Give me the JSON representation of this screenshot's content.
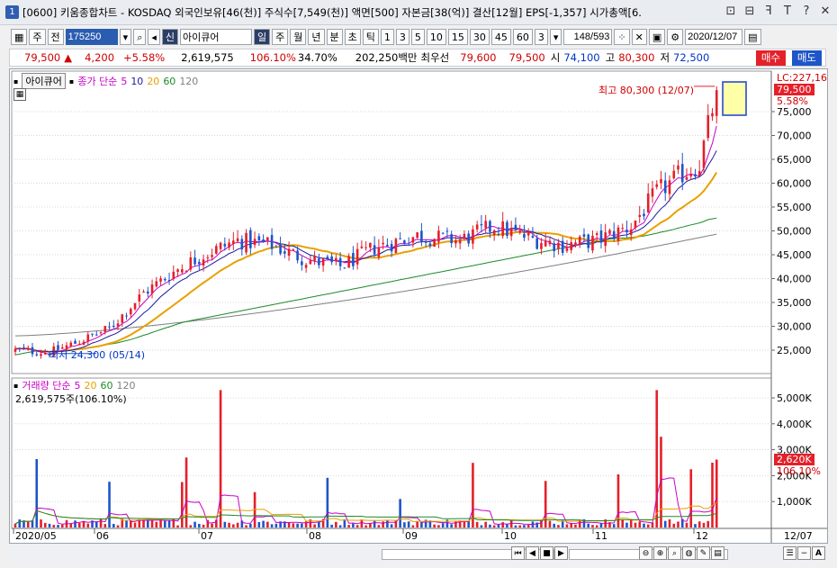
{
  "window": {
    "number": "1",
    "title": "[0600] 키움종합차트 - KOSDAQ 외국인보유[46(천)] 주식수[7,549(천)] 액면[500] 자본금[38(억)] 결산[12월] EPS[-1,357] 시가총액[6.",
    "buttons": [
      "⊡",
      "⊟",
      "ꟻ",
      "T",
      "?",
      "✕"
    ]
  },
  "toolbar": {
    "mode1": "주",
    "mode2": "전",
    "code": "175250",
    "badge": "신",
    "stock_name": "아이큐어",
    "periods": [
      "일",
      "주",
      "월",
      "년",
      "분",
      "초",
      "틱"
    ],
    "active_period": "일",
    "intervals": [
      "1",
      "3",
      "5",
      "10",
      "15",
      "30",
      "45",
      "60"
    ],
    "interval_value": "3",
    "page": "148/593",
    "date": "2020/12/07"
  },
  "quote": {
    "price": "79,500",
    "arrow": "▲",
    "change": "4,200",
    "change_pct": "+5.58%",
    "volume": "2,619,575",
    "volume_ratio": "106.10%",
    "turnover": "34.70%",
    "amount": "202,250백만",
    "best_ask_label": "최우선",
    "ask": "79,600",
    "bid": "79,500",
    "open_label": "시",
    "open": "74,100",
    "high_label": "고",
    "high": "80,300",
    "low_label": "저",
    "low": "72,500",
    "buy_label": "매수",
    "sell_label": "매도"
  },
  "price_panel": {
    "stock_tag": "아이큐어",
    "ma_label": "종가 단순",
    "ma_periods": [
      "5",
      "10",
      "20",
      "60",
      "120"
    ],
    "lc_label": "LC:227,16",
    "last_price_tag": "79,500",
    "last_pct_tag": "5.58%",
    "high_annotation": "최고 80,300 (12/07)",
    "low_annotation": "최저 24,300 (05/14)",
    "y_ticks": [
      "75,000",
      "70,000",
      "65,000",
      "60,000",
      "55,000",
      "50,000",
      "45,000",
      "40,000",
      "35,000",
      "30,000",
      "25,000"
    ]
  },
  "volume_panel": {
    "title": "거래량 단순",
    "ma_periods": [
      "5",
      "20",
      "60",
      "120"
    ],
    "current": "2,619,575주(106.10%)",
    "last_tag": "2,620K",
    "last_pct_tag": "106.10%",
    "y_ticks": [
      "5,000K",
      "4,000K",
      "3,000K",
      "2,000K",
      "1,000K"
    ]
  },
  "x_axis": [
    "2020/05",
    "06",
    "07",
    "08",
    "09",
    "10",
    "11",
    "12",
    "12/07"
  ],
  "colors": {
    "up": "#e4202a",
    "down": "#1e55c8",
    "ma5": "#c800c8",
    "ma10": "#1a1aa0",
    "ma20": "#e8a000",
    "ma60": "#1d8a2a",
    "ma120": "#808080"
  }
}
